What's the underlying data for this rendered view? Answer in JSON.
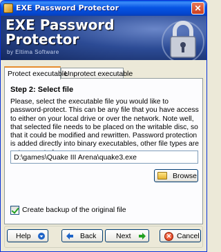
{
  "window": {
    "title": "EXE Password Protector",
    "close_glyph": "✕"
  },
  "banner": {
    "title_line1": "EXE Password",
    "title_line2": "Protector",
    "subtitle": "by Eltima Software",
    "art": "padlock-icon"
  },
  "tabs": [
    {
      "label": "Protect executable",
      "active": true
    },
    {
      "label": "Unprotect executable",
      "active": false
    }
  ],
  "step": {
    "title": "Step 2: Select file",
    "description": "Please, select the executable file you would like to password-protect. This can be any file that you have access to either on your local drive or over the network. Note well, that selected file needs to be placed on the writable disc, so that it could be modified and rewritten. Password protection is added directly into binary executables, other file types are not supported."
  },
  "file_input": {
    "value": "D:\\games\\Quake III Arena\\quake3.exe"
  },
  "browse_button": {
    "label": "Browse",
    "icon": "folder-icon"
  },
  "backup_checkbox": {
    "label": "Create backup of the original file",
    "checked": true
  },
  "footer": {
    "help_label": "Help",
    "back_label": "Back",
    "next_label": "Next",
    "cancel_label": "Cancel",
    "cancel_glyph": "✕"
  },
  "colors": {
    "titlebar": "#0755e4",
    "banner": "#2c4b95",
    "active_tab_accent": "#e68b2c",
    "nav_arrow": "#1e64c8",
    "next_arrow": "#21a121"
  }
}
